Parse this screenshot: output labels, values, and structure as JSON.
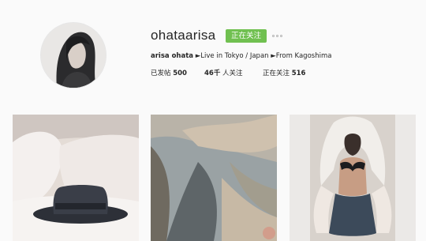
{
  "profile": {
    "username": "ohataarisa",
    "follow_label": "正在关注",
    "bio": {
      "full_name": "arisa ohata",
      "text": "►Live in Tokyo / Japan ►From Kagoshima"
    },
    "stats": {
      "posts_label": "已发帖",
      "posts_count": "500",
      "followers_count": "46千",
      "followers_label": "人关注",
      "following_label": "正在关注",
      "following_count": "516"
    }
  },
  "icons": {
    "more": "more-options-icon"
  },
  "colors": {
    "follow_button": "#70c050",
    "background": "#fafafa"
  }
}
